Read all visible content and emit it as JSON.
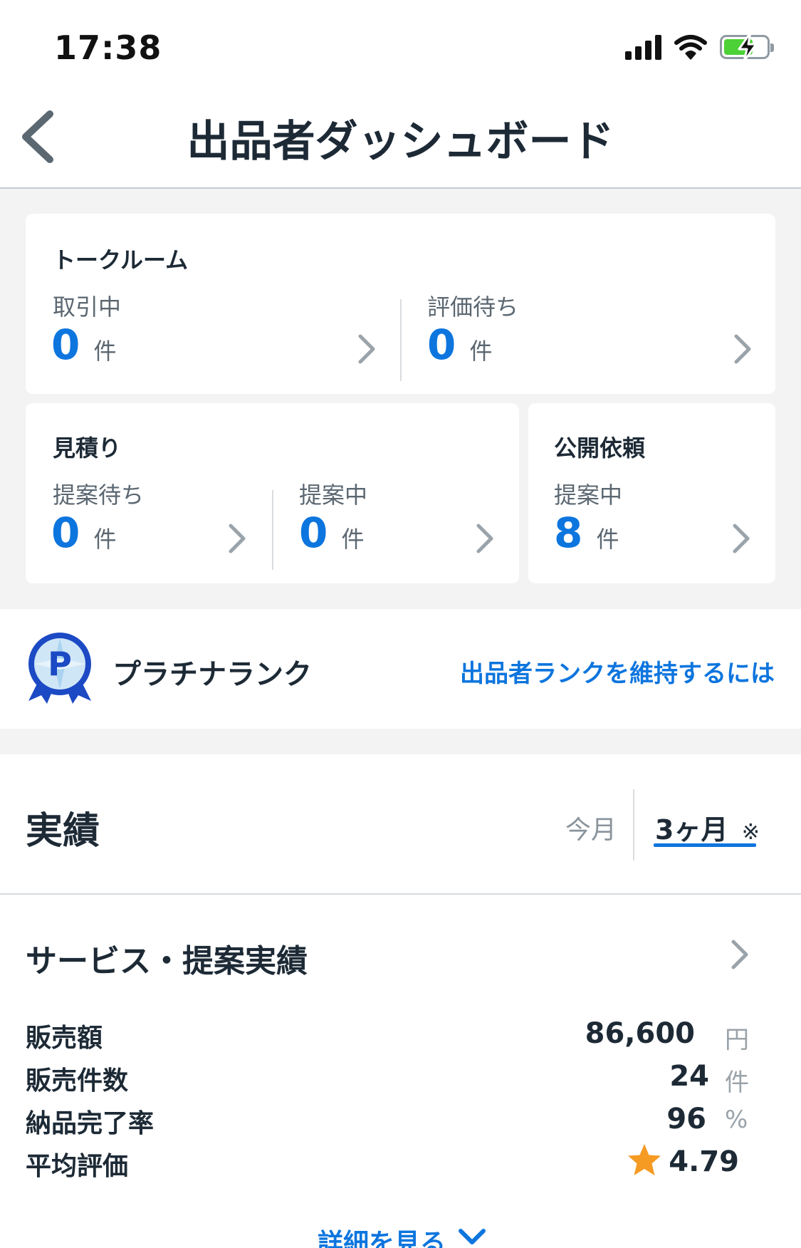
{
  "status_bar": {
    "time": "17:38"
  },
  "header": {
    "title": "出品者ダッシュボード"
  },
  "talkroom": {
    "title": "トークルーム",
    "in_progress": {
      "label": "取引中",
      "count": "0",
      "unit": "件"
    },
    "awaiting_review": {
      "label": "評価待ち",
      "count": "0",
      "unit": "件"
    }
  },
  "estimate": {
    "title": "見積り",
    "awaiting_proposal": {
      "label": "提案待ち",
      "count": "0",
      "unit": "件"
    },
    "proposing": {
      "label": "提案中",
      "count": "0",
      "unit": "件"
    }
  },
  "public_request": {
    "title": "公開依頼",
    "proposing": {
      "label": "提案中",
      "count": "8",
      "unit": "件"
    }
  },
  "rank": {
    "badge_letter": "P",
    "label": "プラチナランク",
    "link": "出品者ランクを維持するには"
  },
  "results": {
    "title": "実績",
    "tabs": [
      {
        "label": "今月",
        "active": false
      },
      {
        "label": "3ヶ月",
        "mark": "※",
        "active": true
      }
    ]
  },
  "service": {
    "title": "サービス・提案実績",
    "stats": [
      {
        "label": "販売額",
        "value": "86,600",
        "unit": "円"
      },
      {
        "label": "販売件数",
        "value": "24",
        "unit": "件"
      },
      {
        "label": "納品完了率",
        "value": "96",
        "unit": "%"
      },
      {
        "label": "平均評価",
        "value": "4.79",
        "icon": "star-icon"
      }
    ]
  },
  "detail_link": "詳細を見る",
  "colors": {
    "accent": "#0d75de",
    "text": "#1d2a36",
    "background_gray": "#f3f3f3",
    "star": "#f59a23"
  }
}
